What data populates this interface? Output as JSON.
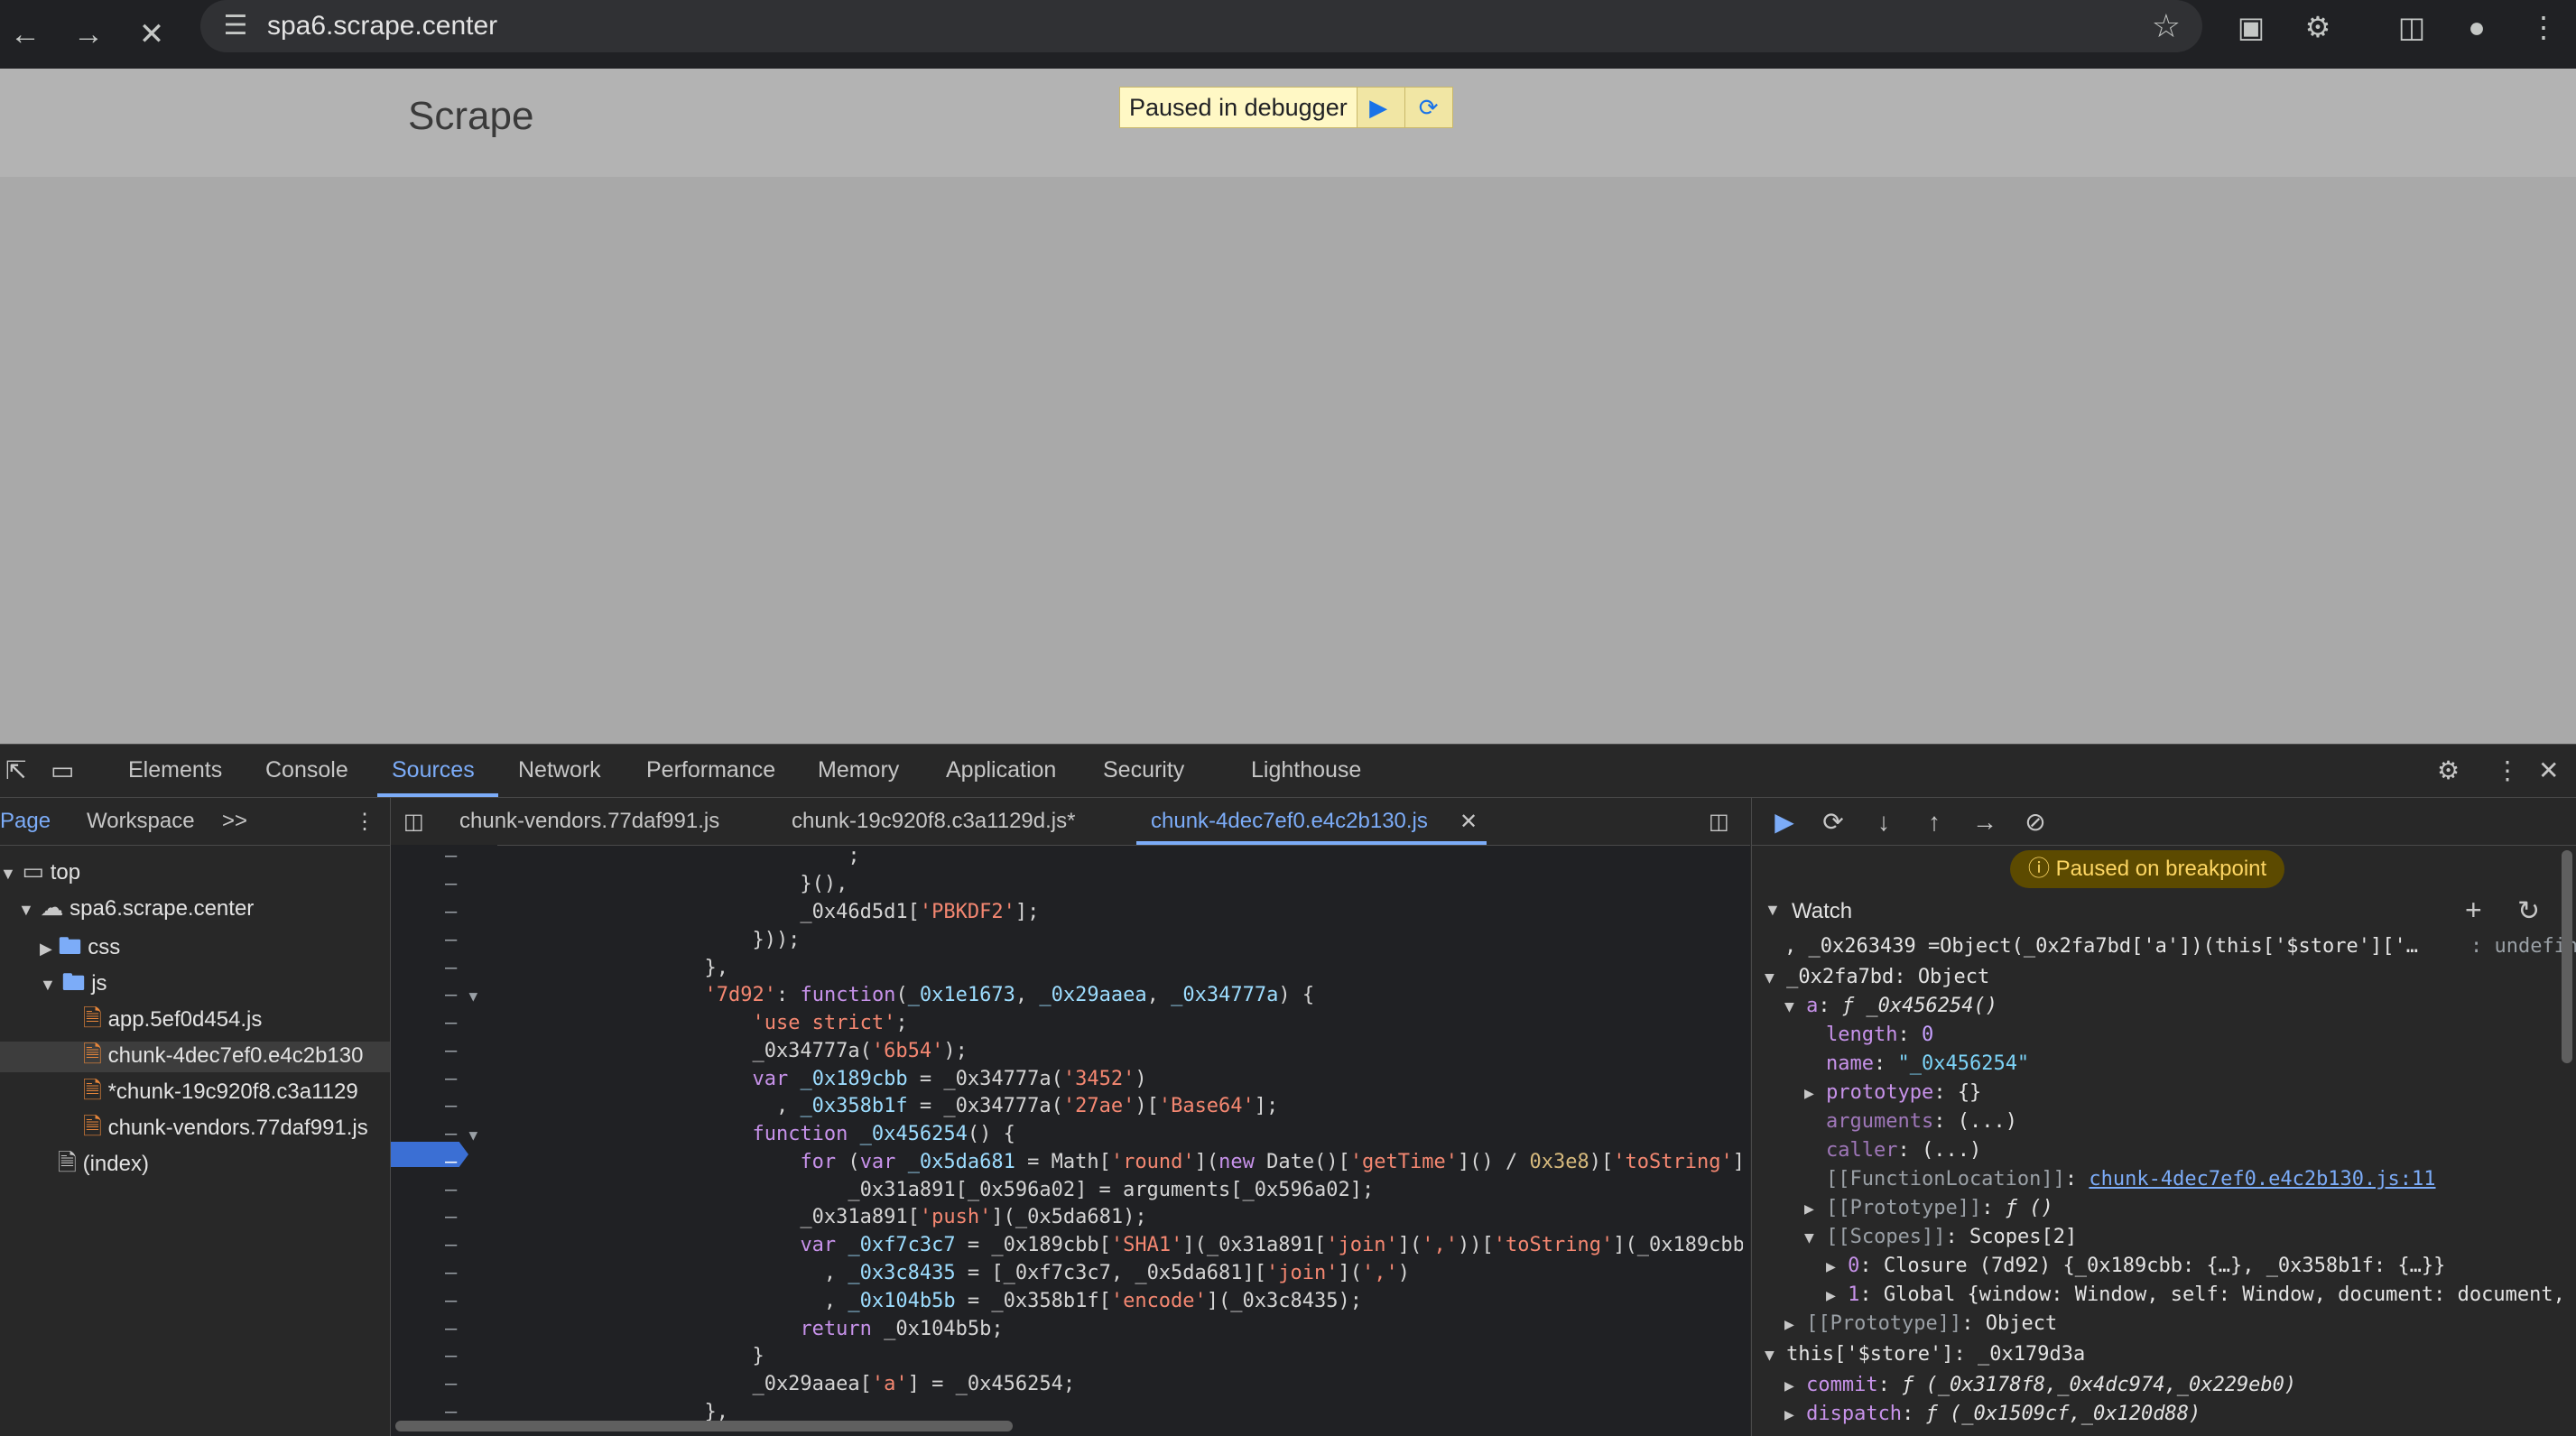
{
  "browser": {
    "url": "spa6.scrape.center",
    "icons": [
      "back-icon",
      "forward-icon",
      "stop-icon",
      "tune-icon",
      "star-icon",
      "cast-icon",
      "extensions-icon",
      "side-panel-icon",
      "profile-icon",
      "menu-icon"
    ]
  },
  "page": {
    "site_title": "Scrape",
    "pause_overlay": {
      "text": "Paused in debugger"
    }
  },
  "devtools": {
    "tabs": [
      "Elements",
      "Console",
      "Sources",
      "Network",
      "Performance",
      "Memory",
      "Application",
      "Security",
      "Lighthouse"
    ],
    "active_tab": "Sources",
    "navigator": {
      "tabs": [
        "Page",
        "Workspace"
      ],
      "more": ">>",
      "tree": {
        "top": "top",
        "domain": "spa6.scrape.center",
        "css": "css",
        "js": "js",
        "files": [
          "app.5ef0d454.js",
          "chunk-4dec7ef0.e4c2b130",
          "*chunk-19c920f8.c3a1129",
          "chunk-vendors.77daf991.js"
        ],
        "index": "(index)"
      }
    },
    "editor": {
      "tabs": [
        "chunk-vendors.77daf991.js",
        "chunk-19c920f8.c3a1129d.js*",
        "chunk-4dec7ef0.e4c2b130.js"
      ],
      "active_tab": "chunk-4dec7ef0.e4c2b130.js"
    },
    "debugger": {
      "paused_label": "Paused on breakpoint",
      "watch_label": "Watch",
      "watch": {
        "expr1": ", _0x263439 =Object(_0x2fa7bd['a'])(this['$store']['…",
        "expr1_val": "undefined",
        "obj_name": "_0x2fa7bd",
        "obj_type": "Object",
        "a_label": "a",
        "a_val": "ƒ _0x456254()",
        "length_k": "length",
        "length_v": "0",
        "name_k": "name",
        "name_v": "\"_0x456254\"",
        "prototype_k": "prototype",
        "prototype_v": "{}",
        "arguments_k": "arguments",
        "arguments_v": "(...)",
        "caller_k": "caller",
        "caller_v": "(...)",
        "fnloc_k": "[[FunctionLocation]]",
        "fnloc_v": "chunk-4dec7ef0.e4c2b130.js:11",
        "proto_k": "[[Prototype]]",
        "proto_v": "ƒ ()",
        "scopes_k": "[[Scopes]]",
        "scopes_v": "Scopes[2]",
        "scope0_k": "0",
        "scope0_v": "Closure (7d92) {_0x189cbb: {…}, _0x358b1f: {…}}",
        "scope1_k": "1",
        "scope1_v": "Global {window: Window, self: Window, document: document,",
        "objproto_k": "[[Prototype]]",
        "objproto_v": "Object",
        "store_k": "this['$store']",
        "store_v": "_0x179d3a",
        "commit_k": "commit",
        "commit_v": "ƒ (_0x3178f8,_0x4dc974,_0x229eb0)",
        "dispatch_k": "dispatch",
        "dispatch_v": "ƒ (_0x1509cf,_0x120d88)"
      }
    }
  }
}
